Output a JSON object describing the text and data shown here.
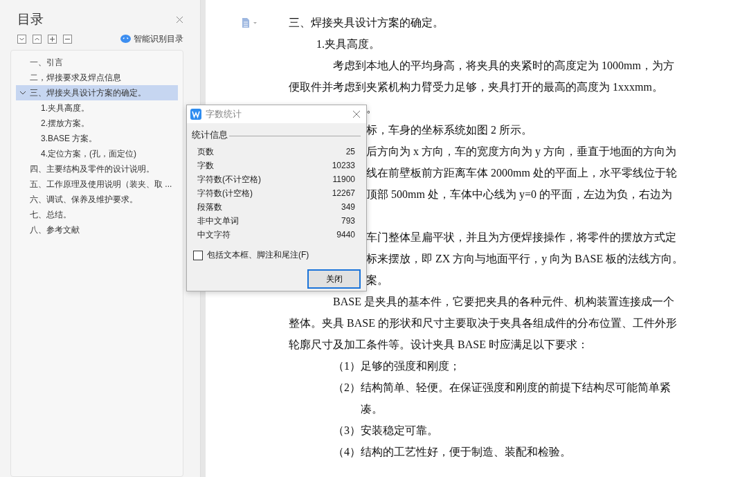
{
  "outline": {
    "title": "目录",
    "smart_button": "智能识别目录",
    "items": [
      {
        "label": "一、引言",
        "selected": false
      },
      {
        "label": "二，焊接要求及焊点信息",
        "selected": false
      },
      {
        "label": "三、焊接夹具设计方案的确定。",
        "selected": true,
        "expanded": true,
        "children": [
          {
            "label": "1.夹具高度。",
            "selected": false
          },
          {
            "label": "2.摆放方案。",
            "selected": false
          },
          {
            "label": "3.BASE 方案。",
            "selected": false
          },
          {
            "label": "4.定位方案，(孔，面定位)",
            "selected": false
          }
        ]
      },
      {
        "label": "四、主要结构及零件的设计说明。",
        "selected": false
      },
      {
        "label": "五、工作原理及使用说明（装夹、取 ...",
        "selected": false
      },
      {
        "label": "六、调试、保养及维护要求。",
        "selected": false
      },
      {
        "label": "七、总结。",
        "selected": false
      },
      {
        "label": "八、参考文献",
        "selected": false
      }
    ]
  },
  "document": {
    "lines": [
      {
        "kind": "heading",
        "text": "三、焊接夹具设计方案的确定。"
      },
      {
        "kind": "subheading",
        "text": "1.夹具高度。"
      },
      {
        "kind": "first",
        "text": "考虑到本地人的平均身高，将夹具的夹紧时的高度定为 1000mm，为方"
      },
      {
        "kind": "body",
        "text": "便取件并考虑到夹紧机构力臂受力足够，夹具打开的最高的高度为 1xxxmm。"
      },
      {
        "kind": "covered",
        "text": "。"
      },
      {
        "kind": "covered",
        "text": "标，车身的坐标系统如图 2 所示。"
      },
      {
        "kind": "covered",
        "text": "后方向为 x 方向，车的宽度方向为 y 方向，垂直于地面的方向为"
      },
      {
        "kind": "covered",
        "text": "线在前壁板前方距离车体 2000mm 处的平面上，水平零线位于轮"
      },
      {
        "kind": "covered",
        "text": "顶部 500mm 处，车体中心线为 y=0 的平面，左边为负，右边为"
      },
      {
        "kind": "blank"
      },
      {
        "kind": "covered",
        "text": "车门整体呈扁平状，并且为方便焊接操作，将零件的摆放方式定"
      },
      {
        "kind": "covered",
        "text": "标来摆放，即 ZX 方向与地面平行，y 向为 BASE 板的法线方向。"
      },
      {
        "kind": "covered",
        "text": "案。"
      },
      {
        "kind": "first",
        "text": "BASE 是夹具的基本件，它要把夹具的各种元件、机构装置连接成一个"
      },
      {
        "kind": "body",
        "text": "整体。夹具 BASE 的形状和尺寸主要取决于夹具各组成件的分布位置、工件外形"
      },
      {
        "kind": "body",
        "text": "轮廓尺寸及加工条件等。设计夹具 BASE 时应满足以下要求："
      },
      {
        "kind": "item",
        "number": "（1）",
        "text": "足够的强度和刚度；"
      },
      {
        "kind": "item",
        "number": "（2）",
        "text": "结构简单、轻便。在保证强度和刚度的前提下结构尽可能简单紧凑。"
      },
      {
        "kind": "item",
        "number": "（3）",
        "text": "安装稳定可靠。"
      },
      {
        "kind": "item",
        "number": "（4）",
        "text": "结构的工艺性好，便于制造、装配和检验。"
      }
    ]
  },
  "dialog": {
    "title": "字数统计",
    "group": "统计信息",
    "stats": [
      {
        "label": "页数",
        "value": "25"
      },
      {
        "label": "字数",
        "value": "10233"
      },
      {
        "label": "字符数(不计空格)",
        "value": "11900"
      },
      {
        "label": "字符数(计空格)",
        "value": "12267"
      },
      {
        "label": "段落数",
        "value": "349"
      },
      {
        "label": "非中文单词",
        "value": "793"
      },
      {
        "label": "中文字符",
        "value": "9440"
      }
    ],
    "checkbox": {
      "label": "包括文本框、脚注和尾注(F)",
      "checked": false
    },
    "button": "关闭"
  }
}
